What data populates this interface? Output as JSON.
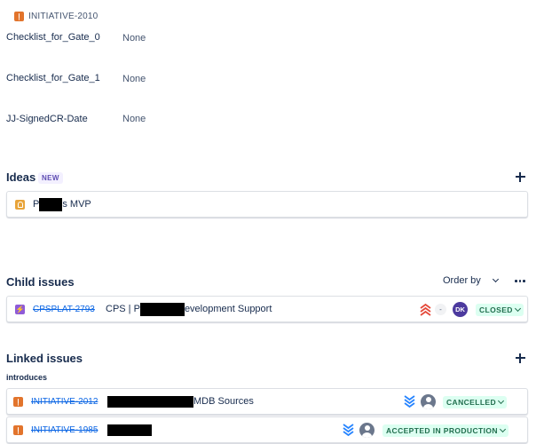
{
  "breadcrumb": {
    "issue_key": "INITIATIVE-2010"
  },
  "fields": [
    {
      "label": "Checklist_for_Gate_0",
      "value": "None"
    },
    {
      "label": "Checklist_for_Gate_1",
      "value": "None"
    },
    {
      "label": "JJ-SignedCR-Date",
      "value": "None"
    }
  ],
  "ideas": {
    "title": "Ideas",
    "badge": "NEW",
    "item": {
      "summary_prefix": "P",
      "summary_suffix": "s MVP"
    }
  },
  "child_issues": {
    "title": "Child issues",
    "order_by_label": "Order by",
    "items": [
      {
        "key": "CPSPLAT-2793",
        "summary_prefix": "CPS | P",
        "summary_suffix": "evelopment Support",
        "priority": "highest",
        "estimate": "-",
        "assignee": "DK",
        "status": "CLOSED"
      }
    ]
  },
  "linked_issues": {
    "title": "Linked issues",
    "relation": "introduces",
    "items": [
      {
        "key": "INITIATIVE-2012",
        "summary_suffix": "MDB Sources",
        "priority": "lowest",
        "status": "CANCELLED"
      },
      {
        "key": "INITIATIVE-1985",
        "summary_suffix": "",
        "priority": "lowest",
        "status": "ACCEPTED IN PRODUCTION"
      }
    ]
  },
  "colors": {
    "link": "#0c66e4",
    "text": "#172b4d",
    "status_green_bg": "#dcfff1",
    "status_green_text": "#216e4e",
    "priority_high": "#e5493a",
    "priority_low": "#2684ff"
  }
}
